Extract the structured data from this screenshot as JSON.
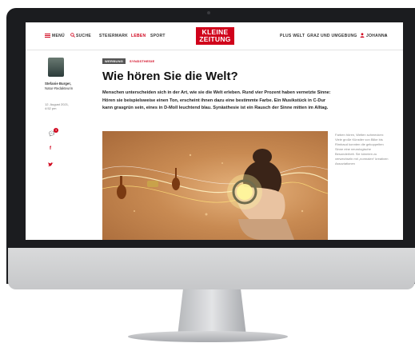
{
  "topbar": {
    "menu_label": "MENÜ",
    "search_label": "SUCHE",
    "sections": [
      "STEIERMARK",
      "LEBEN",
      "SPORT"
    ],
    "active_section": "LEBEN",
    "logo_line1": "KLEINE",
    "logo_line2": "ZEITUNG",
    "plus_label": "PLUS WELT",
    "region_label": "GRAZ UND UMGEBUNG",
    "user_label": "JOHANNA"
  },
  "author": {
    "name": "Stefanie Burger,",
    "role": "Natur-Redakteurin",
    "date": "12. August 2021,",
    "time": "4:52 pm",
    "comment_count": "3"
  },
  "article": {
    "tag_primary": "WERBUNG",
    "tag_secondary": "SYNÄSTHESIE",
    "headline": "Wie hören Sie die Welt?",
    "lead": "Menschen unterscheiden sich in der Art, wie sie die Welt erleben. Rund vier Prozent haben vernetzte Sinne: Hören sie beispielsweise einen Ton, erscheint ihnen dazu eine bestimmte Farbe. Ein Musikstück in C-Dur kann grasgrün sein, eines in D-Moll leuchtend blau. Synästhesie ist ein Rausch der Sinne mitten im Alltag.",
    "caption": "Farben hören, Welten schmecken: Viele große Künstler von Bilke bis Rimbaud konnten die gekoppelten Sinne eine neurologische Besonderheit. Sie könnten zu verwechseln mit „normalen“ kreativen Assoziationen"
  },
  "colors": {
    "brand_red": "#d0021b",
    "bezel": "#1b1c1f"
  }
}
